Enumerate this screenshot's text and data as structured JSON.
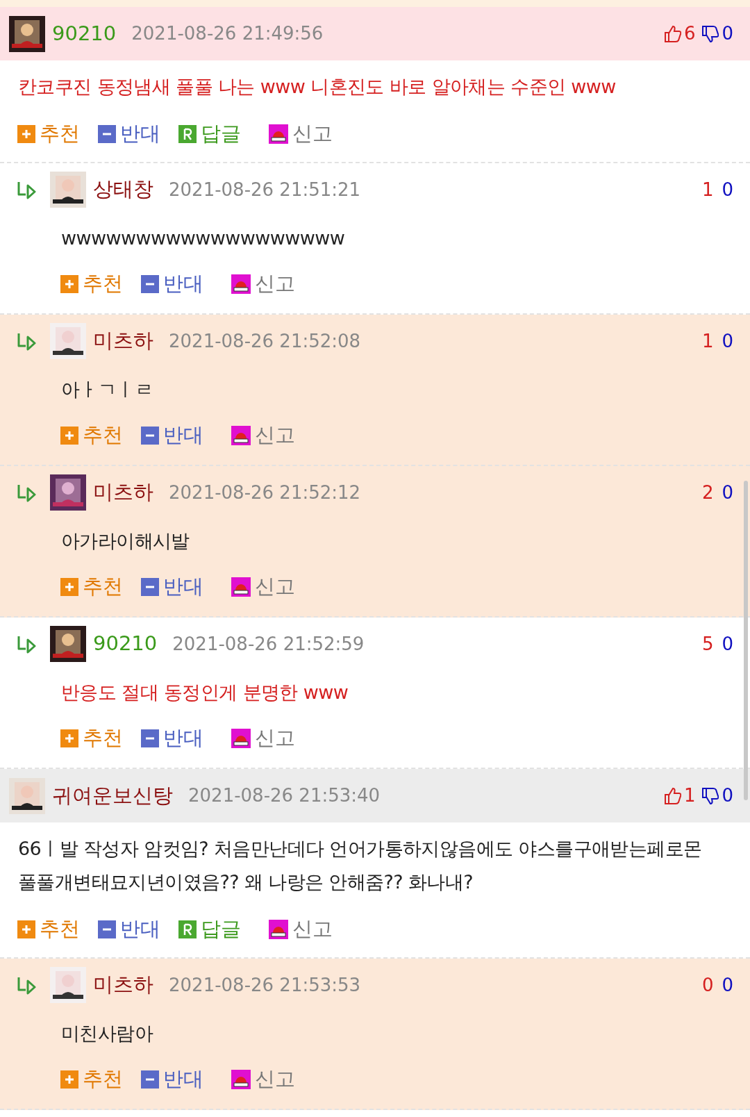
{
  "comments": [
    {
      "kind": "top",
      "author": true,
      "color": "#fde1e4",
      "name": "90210",
      "date": "2021-08-26 21:49:56",
      "up": "6",
      "down": "0",
      "text": [
        "칸코쿠진 동정냄새 풀풀 나는 www 니혼진도 바로 알아채는 수준인 www"
      ],
      "actions": [
        {
          "kind": "recommend",
          "label": "추천"
        },
        {
          "kind": "oppose",
          "label": "반대"
        },
        {
          "kind": "reply",
          "label": "답글"
        },
        {
          "kind": "report",
          "label": "신고"
        }
      ]
    },
    {
      "kind": "reply",
      "author": false,
      "color": "#ffffff",
      "name": "상태창",
      "date": "2021-08-26 21:51:21",
      "up": "1",
      "down": "0",
      "text": [
        "wwwwwwwwwwwwwwwwwww"
      ],
      "actions": [
        {
          "kind": "recommend",
          "label": "추천"
        },
        {
          "kind": "oppose",
          "label": "반대"
        },
        {
          "kind": "report",
          "label": "신고"
        }
      ]
    },
    {
      "kind": "reply",
      "author": false,
      "color": "#fce8d8",
      "name": "미츠하",
      "date": "2021-08-26 21:52:08",
      "up": "1",
      "down": "0",
      "text": [
        "아ㅏㄱㅣㄹ"
      ],
      "actions": [
        {
          "kind": "recommend",
          "label": "추천"
        },
        {
          "kind": "oppose",
          "label": "반대"
        },
        {
          "kind": "report",
          "label": "신고"
        }
      ]
    },
    {
      "kind": "reply",
      "author": false,
      "color": "#fce8d8",
      "name": "미츠하",
      "date": "2021-08-26 21:52:12",
      "up": "2",
      "down": "0",
      "text": [
        "아가라이해시발"
      ],
      "actions": [
        {
          "kind": "recommend",
          "label": "추천"
        },
        {
          "kind": "oppose",
          "label": "반대"
        },
        {
          "kind": "report",
          "label": "신고"
        }
      ]
    },
    {
      "kind": "reply",
      "author": true,
      "color": "#ffffff",
      "name": "90210",
      "date": "2021-08-26 21:52:59",
      "up": "5",
      "down": "0",
      "text": [
        "반응도 절대 동정인게 분명한 www"
      ],
      "actions": [
        {
          "kind": "recommend",
          "label": "추천"
        },
        {
          "kind": "oppose",
          "label": "반대"
        },
        {
          "kind": "report",
          "label": "신고"
        }
      ]
    },
    {
      "kind": "top",
      "author": false,
      "color": "#ececec",
      "name": "귀여운보신탕",
      "date": "2021-08-26 21:53:40",
      "up": "1",
      "down": "0",
      "text": [
        "66ㅣ발 작성자 암컷임? 처음만난데다 언어가통하지않음에도 야스를구애받는페로몬",
        "풀풀개변태묘지년이였음?? 왜 나랑은 안해줌?? 화나내?"
      ],
      "actions": [
        {
          "kind": "recommend",
          "label": "추천"
        },
        {
          "kind": "oppose",
          "label": "반대"
        },
        {
          "kind": "reply",
          "label": "답글"
        },
        {
          "kind": "report",
          "label": "신고"
        }
      ]
    },
    {
      "kind": "reply",
      "author": false,
      "color": "#fce8d8",
      "name": "미츠하",
      "date": "2021-08-26 21:53:53",
      "up": "0",
      "down": "0",
      "text": [
        "미친사람아"
      ],
      "actions": [
        {
          "kind": "recommend",
          "label": "추천"
        },
        {
          "kind": "oppose",
          "label": "반대"
        },
        {
          "kind": "report",
          "label": "신고"
        }
      ]
    }
  ]
}
